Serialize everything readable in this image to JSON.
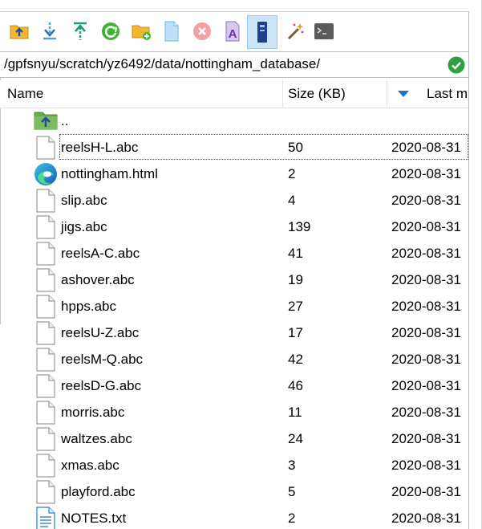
{
  "toolbar": {
    "buttons": [
      {
        "name": "parent-directory-button",
        "icon": "folder-up-icon"
      },
      {
        "name": "download-button",
        "icon": "download-arrow-icon"
      },
      {
        "name": "upload-button",
        "icon": "upload-arrow-icon"
      },
      {
        "name": "refresh-button",
        "icon": "refresh-icon"
      },
      {
        "name": "new-folder-button",
        "icon": "new-folder-icon"
      },
      {
        "name": "new-file-button",
        "icon": "new-file-icon"
      },
      {
        "name": "delete-button",
        "icon": "delete-icon"
      },
      {
        "name": "rename-button",
        "icon": "rename-icon"
      },
      {
        "name": "properties-button",
        "icon": "properties-icon",
        "active": true
      },
      {
        "name": "find-button",
        "icon": "magic-wand-icon"
      },
      {
        "name": "terminal-button",
        "icon": "terminal-icon"
      }
    ]
  },
  "path": {
    "value": "/gpfsnyu/scratch/yz6492/data/nottingham_database/"
  },
  "columns": {
    "name": "Name",
    "size": "Size (KB)",
    "modified": "Last m"
  },
  "parent_row": {
    "name": ".."
  },
  "files": [
    {
      "name": "reelsH-L.abc",
      "size": "50",
      "date": "2020-08-31",
      "icon": "file-icon"
    },
    {
      "name": "nottingham.html",
      "size": "2",
      "date": "2020-08-31",
      "icon": "edge-browser-icon"
    },
    {
      "name": "slip.abc",
      "size": "4",
      "date": "2020-08-31",
      "icon": "file-icon"
    },
    {
      "name": "jigs.abc",
      "size": "139",
      "date": "2020-08-31",
      "icon": "file-icon"
    },
    {
      "name": "reelsA-C.abc",
      "size": "41",
      "date": "2020-08-31",
      "icon": "file-icon"
    },
    {
      "name": "ashover.abc",
      "size": "19",
      "date": "2020-08-31",
      "icon": "file-icon"
    },
    {
      "name": "hpps.abc",
      "size": "27",
      "date": "2020-08-31",
      "icon": "file-icon"
    },
    {
      "name": "reelsU-Z.abc",
      "size": "17",
      "date": "2020-08-31",
      "icon": "file-icon"
    },
    {
      "name": "reelsM-Q.abc",
      "size": "42",
      "date": "2020-08-31",
      "icon": "file-icon"
    },
    {
      "name": "reelsD-G.abc",
      "size": "46",
      "date": "2020-08-31",
      "icon": "file-icon"
    },
    {
      "name": "morris.abc",
      "size": "11",
      "date": "2020-08-31",
      "icon": "file-icon"
    },
    {
      "name": "waltzes.abc",
      "size": "24",
      "date": "2020-08-31",
      "icon": "file-icon"
    },
    {
      "name": "xmas.abc",
      "size": "3",
      "date": "2020-08-31",
      "icon": "file-icon"
    },
    {
      "name": "playford.abc",
      "size": "5",
      "date": "2020-08-31",
      "icon": "file-icon"
    },
    {
      "name": "NOTES.txt",
      "size": "2",
      "date": "2020-08-31",
      "icon": "text-file-icon"
    }
  ],
  "colors": {
    "selection": "#cce4f7",
    "sort_arrow": "#1a73c8",
    "ok": "#2ea043"
  }
}
